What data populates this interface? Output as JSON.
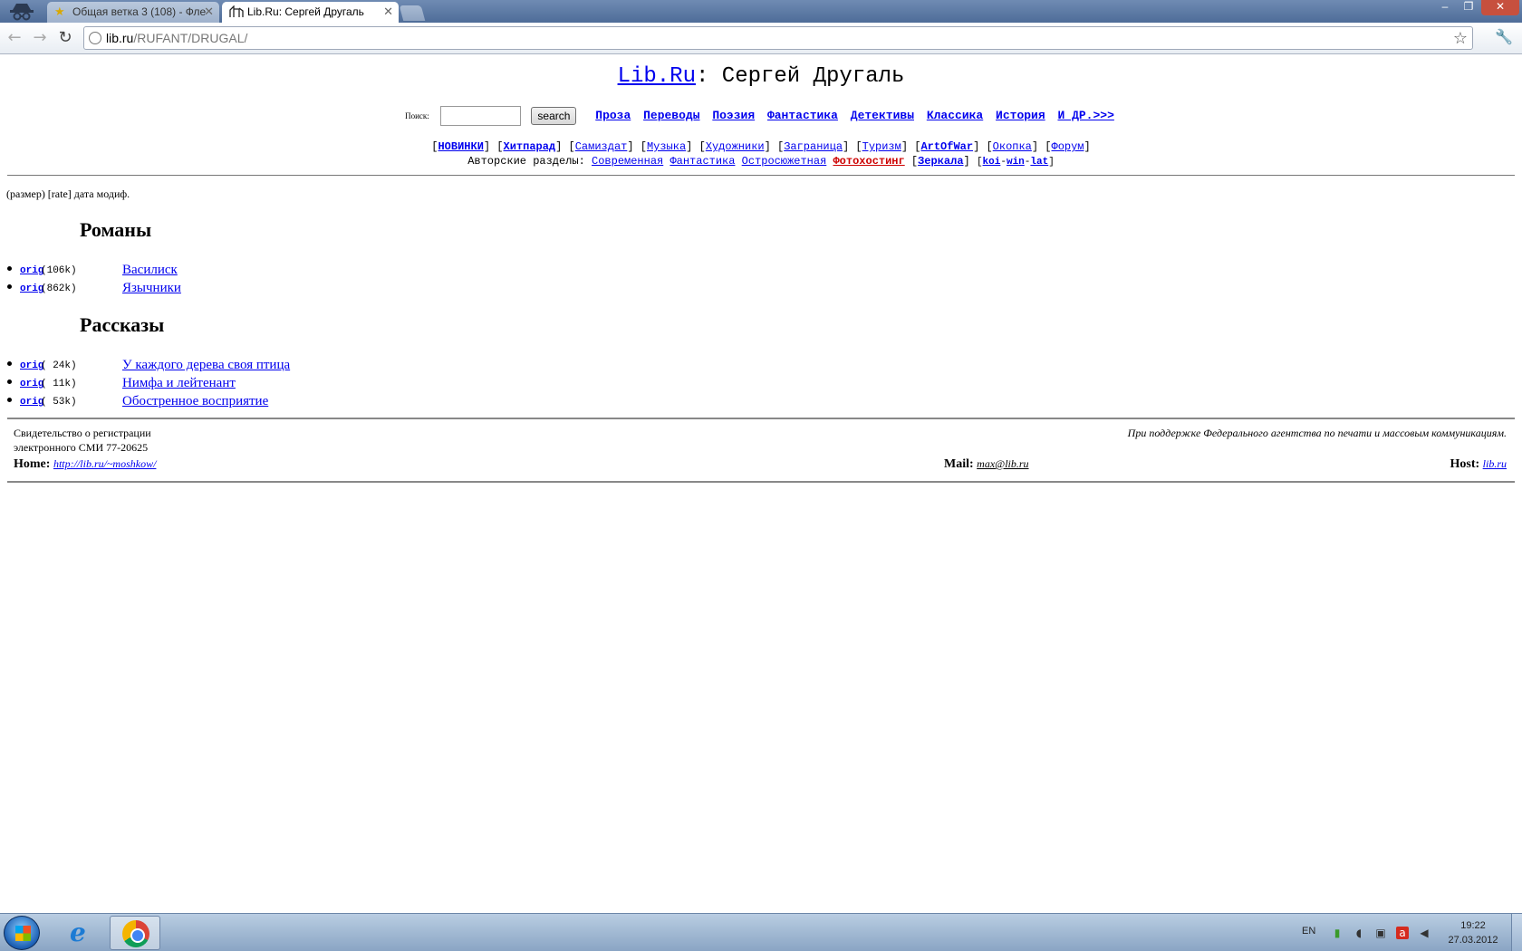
{
  "browser": {
    "tabs": [
      {
        "title": "Общая ветка 3 (108) - Фле",
        "favicon": "star-favicon"
      },
      {
        "title": "Lib.Ru: Сергей Другаль",
        "favicon": "libru-favicon"
      }
    ],
    "url_host": "lib.ru",
    "url_path": "/RUFANT/DRUGAL/",
    "window_controls": {
      "minimize": "–",
      "restore": "❐",
      "close": "✕"
    }
  },
  "page": {
    "site_link": "Lib.Ru",
    "title_sep": ":",
    "author": "Сергей Другаль",
    "search_label": "Поиск:",
    "search_button": "search",
    "genre_links": [
      "Проза",
      "Переводы",
      "Поэзия",
      "Фантастика",
      "Детективы",
      "Классика",
      "История",
      "И ДР.>>>"
    ],
    "nav1": [
      "НОВИНКИ",
      "Хитпарад",
      "Самиздат",
      "Музыка",
      "Художники",
      "Заграница",
      "Туризм",
      "ArtOfWar",
      "Окопка",
      "Форум"
    ],
    "nav2_label": "Авторские разделы:",
    "nav2_links": [
      "Современная",
      "Фантастика",
      "Остросюжетная"
    ],
    "nav2_photo": "Фотохостинг",
    "nav2_mirrors": "Зеркала",
    "encodings": [
      "koi",
      "win",
      "lat"
    ],
    "legend": "(размер) [rate] дата модиф.",
    "sections": [
      {
        "title": "Романы",
        "items": [
          {
            "orig": "orig",
            "size": "(106k)",
            "title": "Василиск"
          },
          {
            "orig": "orig",
            "size": "(862k)",
            "title": "Язычники"
          }
        ]
      },
      {
        "title": "Рассказы",
        "items": [
          {
            "orig": "orig",
            "size": "( 24k)",
            "title": "У каждого дерева своя птица"
          },
          {
            "orig": "orig",
            "size": "( 11k)",
            "title": "Нимфа и лейтенант"
          },
          {
            "orig": "orig",
            "size": "( 53k)",
            "title": "Обостренное восприятие"
          }
        ]
      }
    ],
    "footer": {
      "reg_line1": "Свидетельство о регистрации",
      "reg_line2": "электронного СМИ 77-20625",
      "support": "При поддержке Федерального агентства по печати и массовым коммуникациям.",
      "home_label": "Home:",
      "home_link": "http://lib.ru/~moshkow/",
      "mail_label": "Mail:",
      "mail_link": "max@lib.ru",
      "host_label": "Host:",
      "host_link": "lib.ru"
    }
  },
  "taskbar": {
    "lang": "EN",
    "time": "19:22",
    "date": "27.03.2012"
  },
  "colors": {
    "link": "#0000ee",
    "photohosting": "#cc0000"
  }
}
